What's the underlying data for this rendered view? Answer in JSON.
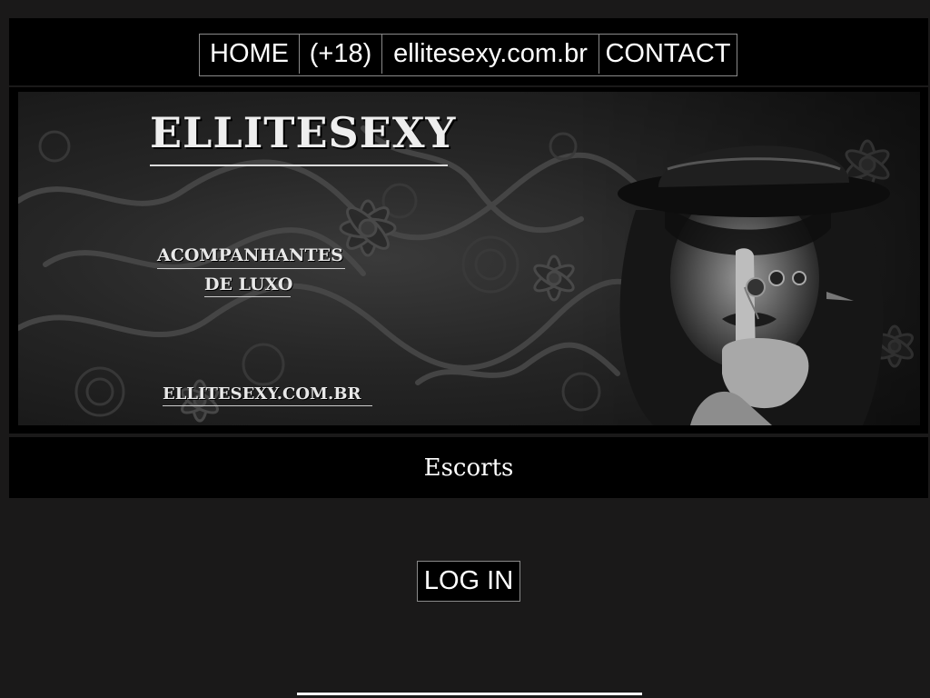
{
  "nav": {
    "items": [
      {
        "label": "HOME"
      },
      {
        "label": "(+18)"
      },
      {
        "label": "ellitesexy.com.br"
      },
      {
        "label": "CONTACT"
      }
    ]
  },
  "banner": {
    "title": "ELLITESEXY",
    "tagline_line1": "ACOMPANHANTES",
    "tagline_line2": "DE LUXO",
    "url": "ELLITESEXY.COM.BR"
  },
  "main": {
    "subtitle": "Escorts",
    "login_label": "LOG IN"
  },
  "colors": {
    "page_background": "#1a1919",
    "panel_background": "#000000",
    "text": "#ffffff",
    "border": "#8a8a8a"
  }
}
